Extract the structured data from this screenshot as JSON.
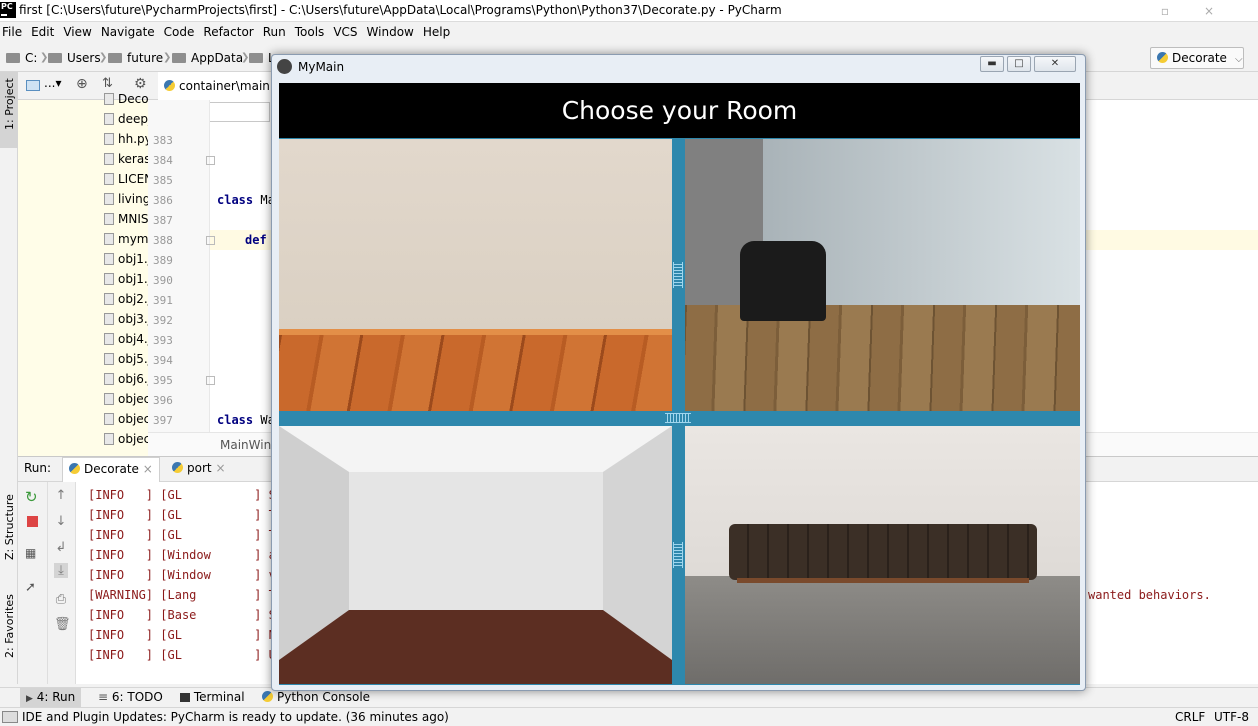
{
  "titlebar": {
    "title": "first [C:\\Users\\future\\PycharmProjects\\first] - C:\\Users\\future\\AppData\\Local\\Programs\\Python\\Python37\\Decorate.py - PyCharm",
    "app_icon": "PC"
  },
  "menu": [
    "File",
    "Edit",
    "View",
    "Navigate",
    "Code",
    "Refactor",
    "Run",
    "Tools",
    "VCS",
    "Window",
    "Help"
  ],
  "breadcrumb": [
    "C:",
    "Users",
    "future",
    "AppData",
    "L"
  ],
  "run_config": "Decorate",
  "side_tabs": {
    "project": "1: Project",
    "structure": "Z: Structure",
    "favorites": "2: Favorites"
  },
  "project_tree": [
    "Decor",
    "deep_",
    "hh.py",
    "keras_",
    "LICEN",
    "living_",
    "MNIS",
    "myma",
    "obj1.j",
    "obj1.j",
    "obj2.j",
    "obj3.j",
    "obj4.jpg",
    "obj5.j",
    "obj6.j",
    "objec",
    "objec",
    "objec"
  ],
  "editor": {
    "tab": "container\\main.py",
    "line_numbers": [
      "383",
      "384",
      "385",
      "386",
      "387",
      "388",
      "389",
      "390",
      "391",
      "392",
      "393",
      "394",
      "395",
      "396",
      "397"
    ],
    "code_class1_kw": "class",
    "code_class1_name": "Ma",
    "code_def_kw": "def",
    "code_class2_kw": "class",
    "code_class2_name": "Wa",
    "footer": "MainWin"
  },
  "run_panel": {
    "label": "Run:",
    "tabs": [
      "Decorate",
      "port"
    ],
    "log": [
      {
        "level": "[INFO   ]",
        "src": "[GL          ]",
        "msg": "Si"
      },
      {
        "level": "[INFO   ]",
        "src": "[GL          ]",
        "msg": "Te"
      },
      {
        "level": "[INFO   ]",
        "src": "[GL          ]",
        "msg": "Te"
      },
      {
        "level": "[INFO   ]",
        "src": "[Window      ]",
        "msg": "au"
      },
      {
        "level": "[INFO   ]",
        "src": "[Window      ]",
        "msg": "vi"
      },
      {
        "level": "[WARNING]",
        "src": "[Lang        ]",
        "msg": "Th"
      },
      {
        "level": "[INFO   ]",
        "src": "[Base        ]",
        "msg": "St"
      },
      {
        "level": "[INFO   ]",
        "src": "[GL          ]",
        "msg": "NU"
      },
      {
        "level": "[INFO   ]",
        "src": "[GL          ]",
        "msg": "Un"
      }
    ],
    "warning_tail": "wanted behaviors."
  },
  "bottom_tabs": [
    "4: Run",
    "6: TODO",
    "Terminal",
    "Python Console"
  ],
  "status": {
    "message": "IDE and Plugin Updates: PyCharm is ready to update. (36 minutes ago)",
    "line_sep": "CRLF",
    "encoding": "UTF-8"
  },
  "kivy": {
    "window_title": "MyMain",
    "header": "Choose your Room",
    "rooms": [
      "room-wood-floor",
      "room-armchair",
      "room-empty-white",
      "room-sofa"
    ]
  },
  "colors": {
    "kivy_border": "#2e88ad",
    "log_text": "#8b1a1a",
    "keyword": "#000080"
  }
}
